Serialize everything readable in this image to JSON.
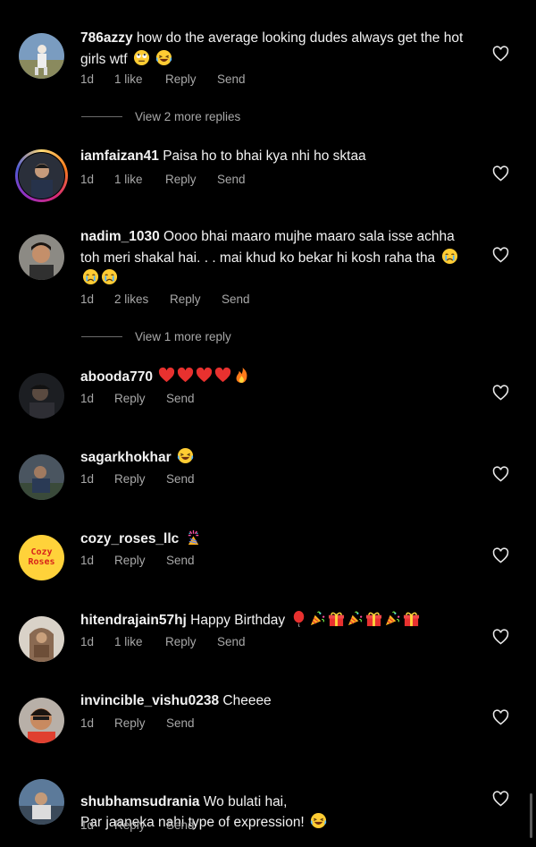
{
  "comments": [
    {
      "username": "786azzy",
      "text": " how do the average looking dudes always get the hot girls wtf",
      "emojis": [
        "rolling-eyes",
        "laughing"
      ],
      "age": "1d",
      "likes": "1 like",
      "reply": "Reply",
      "send": "Send",
      "more_replies": "View 2 more replies"
    },
    {
      "username": "iamfaizan41",
      "text": " Paisa  ho to bhai kya nhi ho sktaa",
      "emojis": [],
      "age": "1d",
      "likes": "1 like",
      "reply": "Reply",
      "send": "Send",
      "has_story_ring": true
    },
    {
      "username": "nadim_1030",
      "text": " Oooo bhai maaro mujhe maaro sala isse achha toh meri shakal hai. . . mai khud ko bekar hi kosh raha tha",
      "emojis": [
        "crying",
        "crying",
        "crying"
      ],
      "age": "1d",
      "likes": "2 likes",
      "reply": "Reply",
      "send": "Send",
      "more_replies": "View 1 more reply"
    },
    {
      "username": "abooda770",
      "text": " ",
      "emojis": [
        "red-heart",
        "red-heart",
        "red-heart",
        "red-heart",
        "fire"
      ],
      "age": "1d",
      "reply": "Reply",
      "send": "Send"
    },
    {
      "username": "sagarkhokhar",
      "text": " ",
      "emojis": [
        "laughing"
      ],
      "age": "1d",
      "reply": "Reply",
      "send": "Send"
    },
    {
      "username": "cozy_roses_llc",
      "text": " ",
      "emojis": [
        "confetti-ball"
      ],
      "age": "1d",
      "reply": "Reply",
      "send": "Send",
      "avatar_text": [
        "Cozy",
        "Roses"
      ]
    },
    {
      "username": "hitendrajain57hj",
      "text": " Happy Birthday ",
      "emojis": [
        "balloon",
        "party-popper",
        "gift",
        "party-popper",
        "gift",
        "party-popper",
        "gift"
      ],
      "age": "1d",
      "likes": "1 like",
      "reply": "Reply",
      "send": "Send"
    },
    {
      "username": "invincible_vishu0238",
      "text": " Cheeee",
      "emojis": [],
      "age": "1d",
      "reply": "Reply",
      "send": "Send"
    },
    {
      "username": "shubhamsudrania",
      "text": " Wo bulati hai,\nPar jaaneka nahi type of expression! ",
      "emojis": [
        "laughing"
      ],
      "age": "1d",
      "reply": "Reply",
      "send": "Send"
    }
  ],
  "colors": {
    "background": "#000000",
    "text": "#f2f2f2",
    "secondary": "#a8a8a8",
    "heart_emoji": "#e8312f"
  }
}
